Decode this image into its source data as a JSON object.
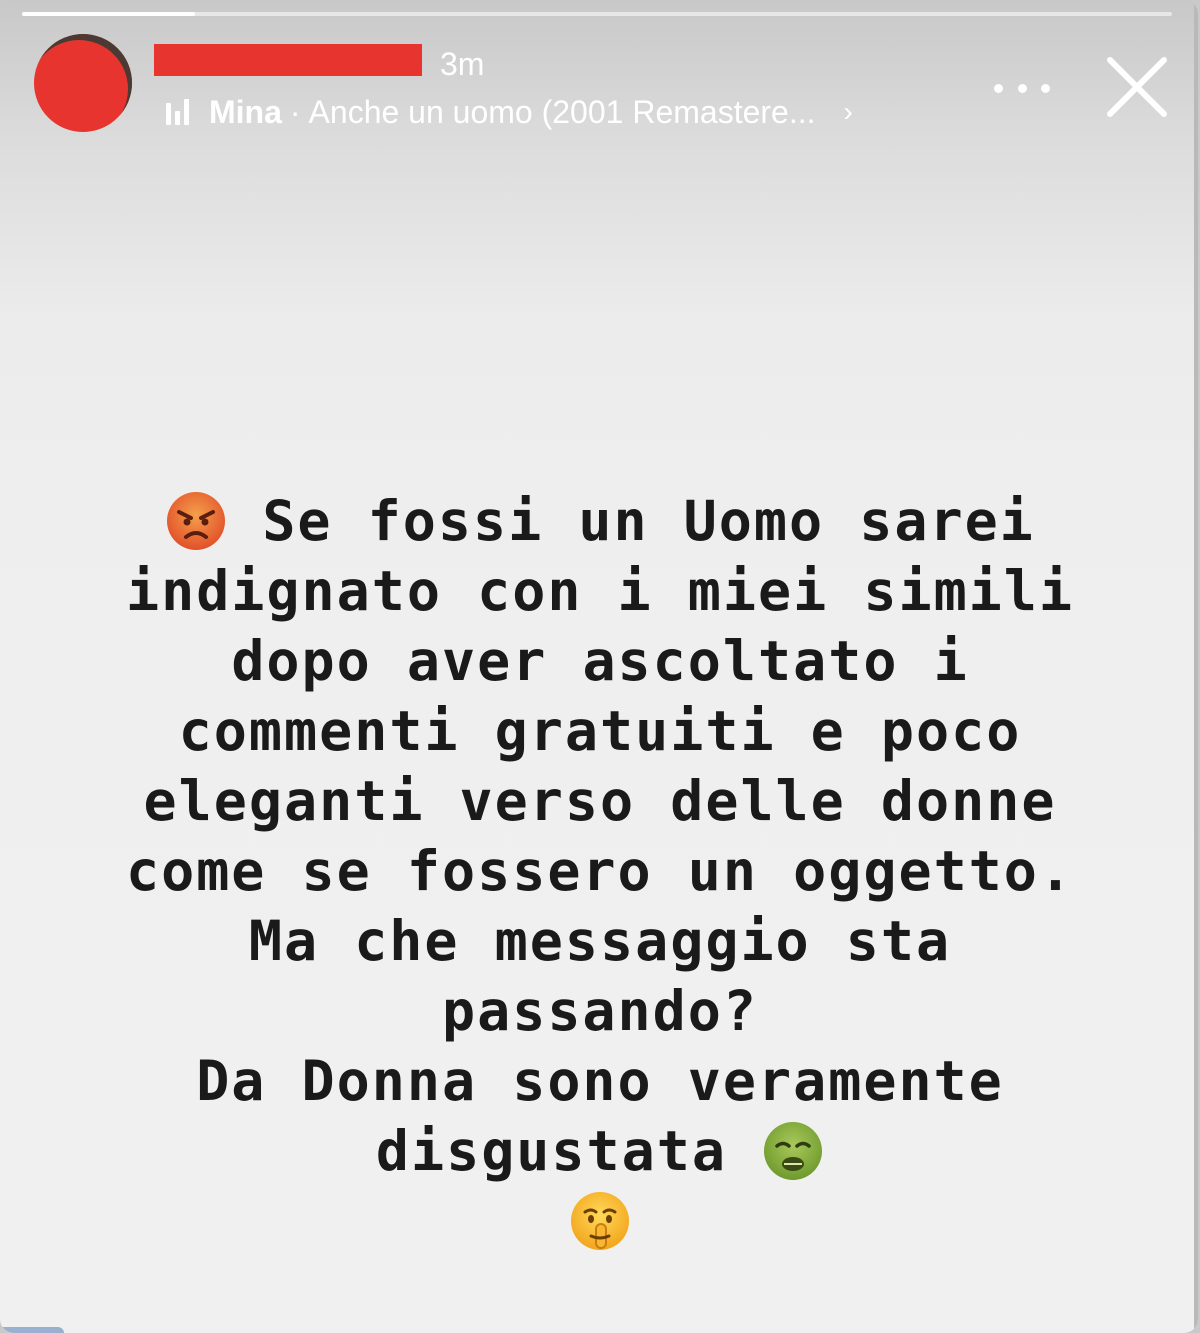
{
  "header": {
    "timestamp": "3m",
    "music": {
      "artist": "Mina",
      "separator": "·",
      "track": "Anche un uomo (2001 Remastere...",
      "chevron": "›"
    }
  },
  "progress": {
    "fraction": 0.15
  },
  "story": {
    "lines": [
      "Se fossi un Uomo sarei",
      "indignato con i miei simili",
      "dopo aver ascoltato i",
      "commenti gratuiti e poco",
      "eleganti verso delle donne",
      "come se fossero un oggetto.",
      "Ma che messaggio sta",
      "passando?",
      "Da Donna sono veramente",
      "disgustata"
    ],
    "emojis": {
      "angry": "angry-face-emoji",
      "nauseated": "nauseated-face-emoji",
      "shushing": "shushing-face-emoji"
    }
  },
  "icons": {
    "more": "more-options-icon",
    "close": "close-icon",
    "music": "music-bars-icon"
  },
  "colors": {
    "redaction": "#e8342e",
    "text": "#1a1a1a",
    "background": "#f0f0f0",
    "overlay_text": "#ffffff"
  }
}
